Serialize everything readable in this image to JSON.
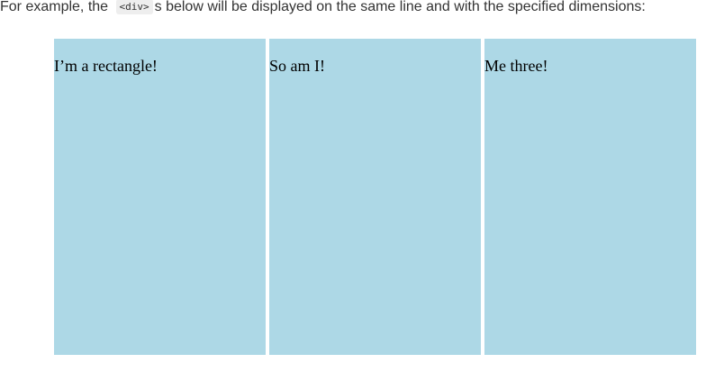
{
  "intro": {
    "before": "For example, the ",
    "code": "<div>",
    "after": "s below will be displayed on the same line and with the specified dimensions:"
  },
  "boxes": [
    {
      "text": "I’m a rectangle!"
    },
    {
      "text": "So am I!"
    },
    {
      "text": "Me three!"
    }
  ],
  "colors": {
    "box_background": "#add8e6",
    "code_background": "#eeeeee",
    "text": "#333333"
  }
}
